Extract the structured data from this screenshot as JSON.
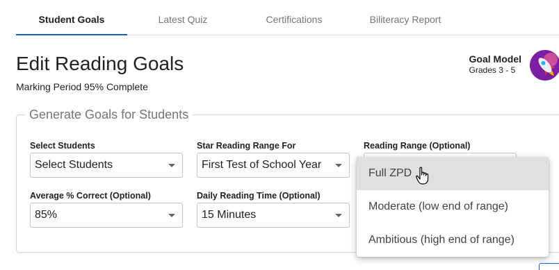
{
  "tabs": [
    {
      "label": "Student Goals",
      "active": true
    },
    {
      "label": "Latest Quiz",
      "active": false
    },
    {
      "label": "Certifications",
      "active": false
    },
    {
      "label": "Biliteracy Report",
      "active": false
    }
  ],
  "header": {
    "title": "Edit Reading Goals",
    "progress": "Marking Period 95% Complete"
  },
  "goal_model": {
    "title": "Goal Model",
    "grades": "Grades 3 - 5",
    "avatar_icon": "rocket-icon"
  },
  "form": {
    "legend": "Generate Goals for Students",
    "select_students": {
      "label": "Select Students",
      "value": "Select Students"
    },
    "star_range": {
      "label": "Star Reading Range For",
      "value": "First Test of School Year"
    },
    "reading_range": {
      "label": "Reading Range (Optional)"
    },
    "avg_correct": {
      "label": "Average % Correct (Optional)",
      "value": "85%"
    },
    "daily_time": {
      "label": "Daily Reading Time (Optional)",
      "value": "15 Minutes"
    }
  },
  "reading_range_menu": {
    "options": [
      "Full ZPD",
      "Moderate (low end of range)",
      "Ambitious (high end of range)"
    ],
    "hovered": "Full ZPD"
  },
  "colors": {
    "accent": "#1565c0",
    "menu_hover": "#e0e0e0",
    "border": "#c4c4c4"
  }
}
